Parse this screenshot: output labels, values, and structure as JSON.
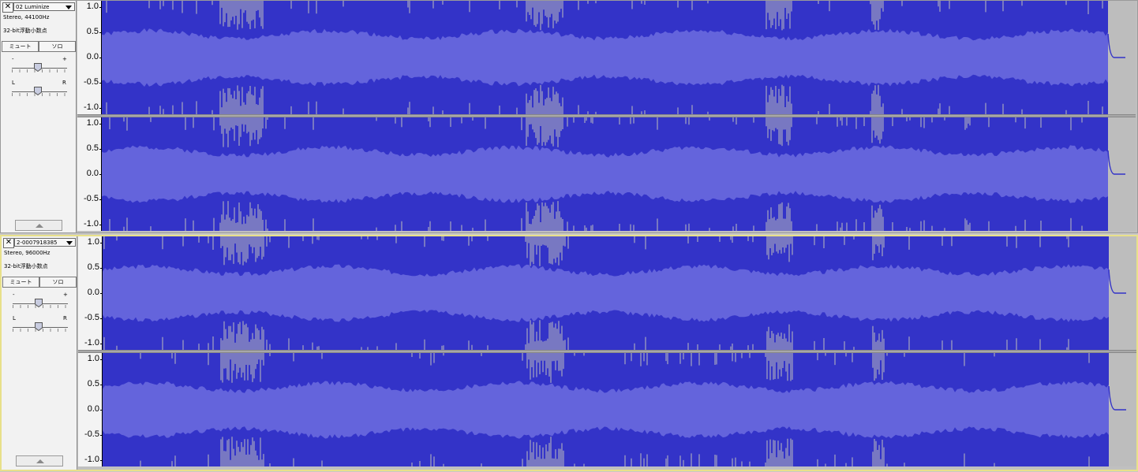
{
  "tracks": [
    {
      "name": "02 Luminize",
      "info_line1": "Stereo, 44100Hz",
      "info_line2": "32-bit浮動小数点",
      "mute_label": "ミュート",
      "solo_label": "ソロ",
      "gain_minus": "-",
      "gain_plus": "+",
      "pan_left": "L",
      "pan_right": "R",
      "close_label": "✕",
      "gain_level": 0.47,
      "pan_level": 0.47,
      "selected": false
    },
    {
      "name": "2-0007918385",
      "info_line1": "Stereo, 96000Hz",
      "info_line2": "32-bit浮動小数点",
      "mute_label": "ミュート",
      "solo_label": "ソロ",
      "gain_minus": "-",
      "gain_plus": "+",
      "pan_left": "L",
      "pan_right": "R",
      "close_label": "✕",
      "gain_level": 0.47,
      "pan_level": 0.47,
      "selected": true
    }
  ],
  "amplitude_ruler": [
    "1.0",
    "0.5",
    "0.0",
    "-0.5",
    "-1.0"
  ],
  "colors": {
    "waveform_peak": "#3333c8",
    "waveform_rms": "#6464dc",
    "clipping": "#bdbdbd",
    "background": "#c0c0c0",
    "selected_track_border": "#e8e08a"
  },
  "icons": {
    "close": "close-icon",
    "menu": "chevron-down-icon",
    "collapse": "collapse-up-icon",
    "slider_thumb": "slider-thumb-icon"
  }
}
